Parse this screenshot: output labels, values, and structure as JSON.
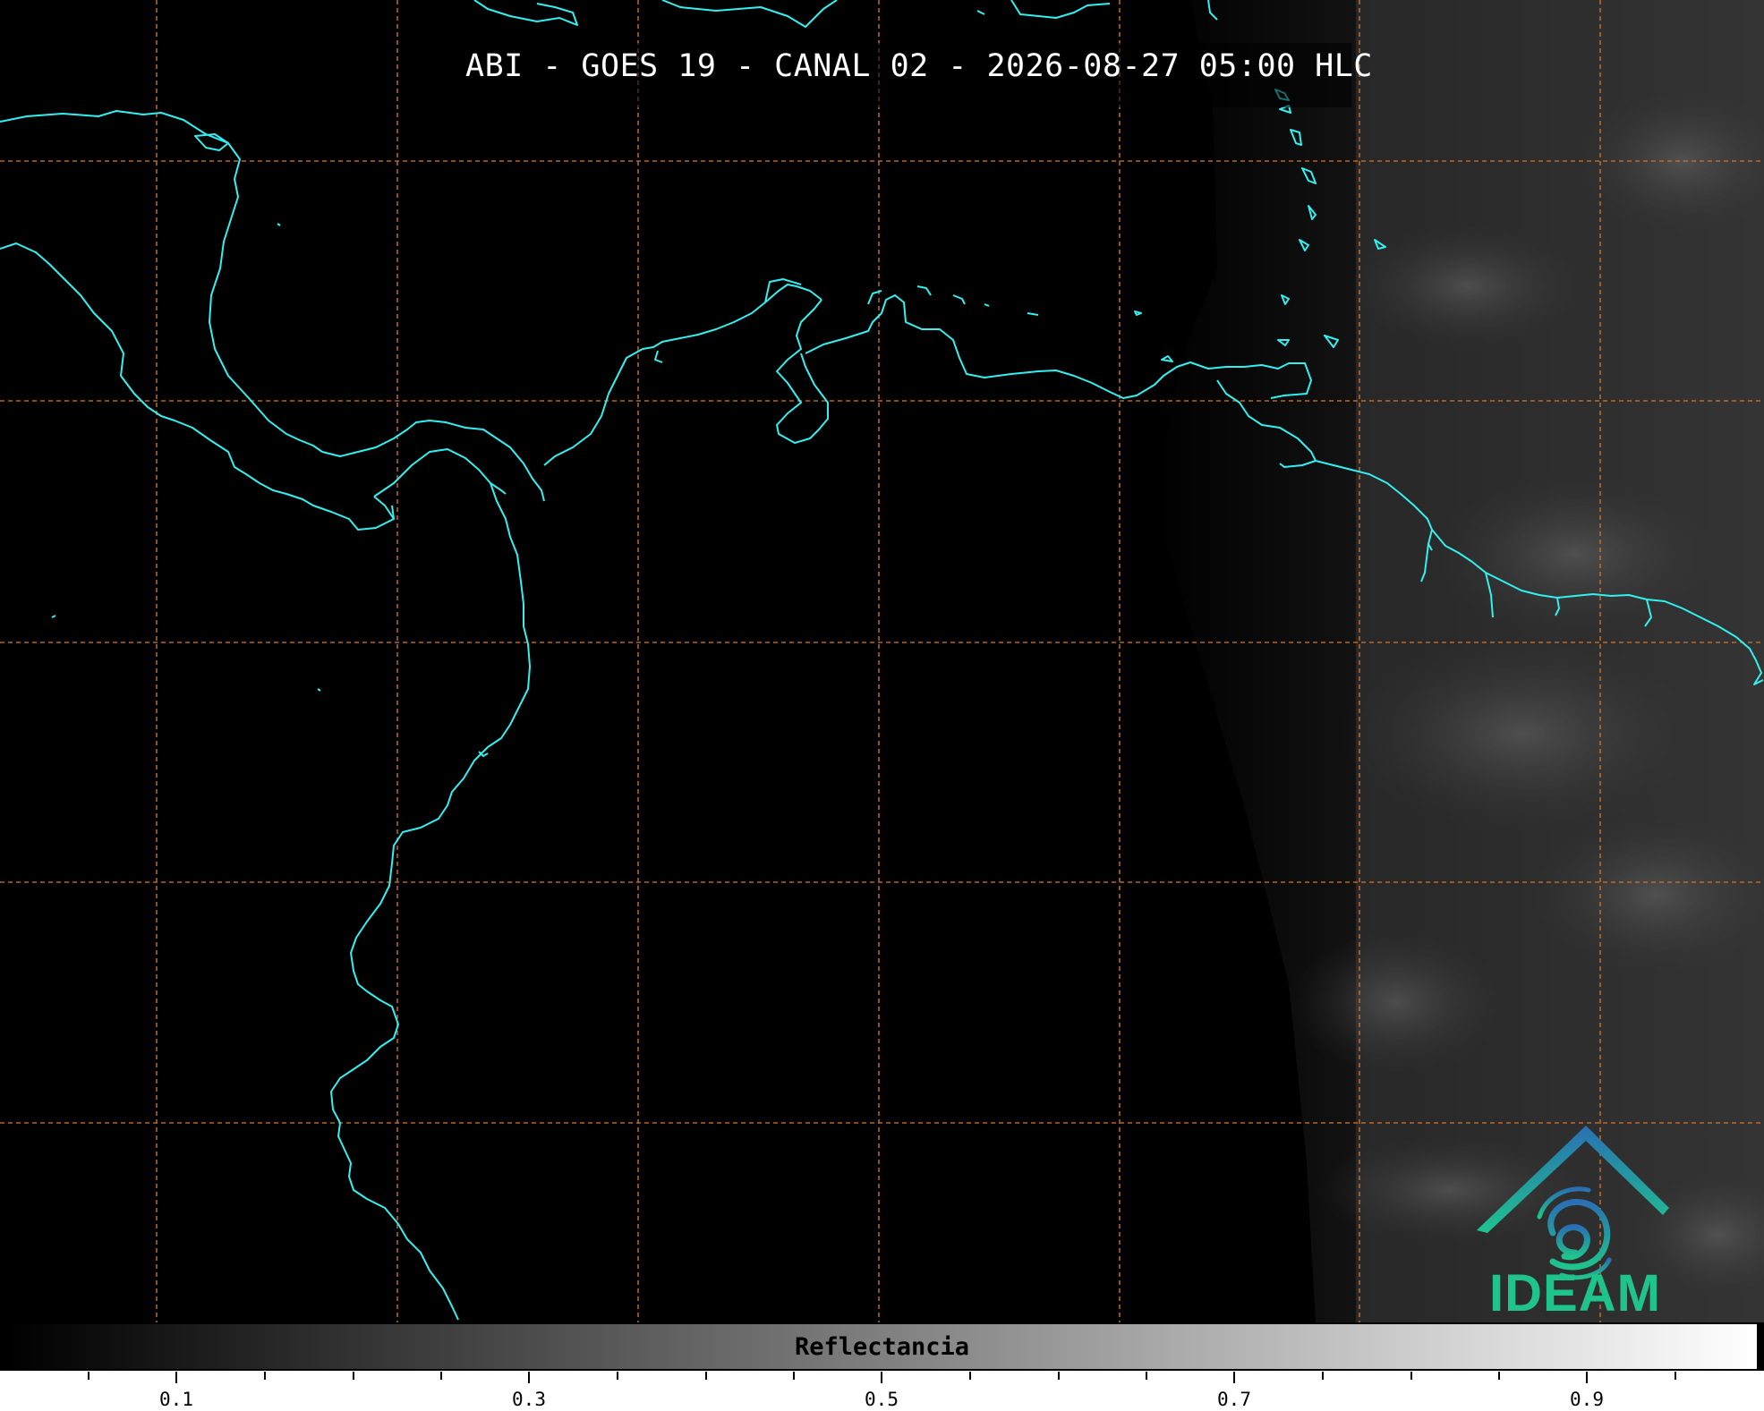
{
  "map": {
    "title": "ABI - GOES 19 - CANAL 02 - 2026-08-27 05:00 HLC",
    "background_color": "#000000",
    "coastline_color": "#33f0f0",
    "graticule_color": "#c8702a",
    "graticule_style": "dashed"
  },
  "colorbar": {
    "label": "Reflectancia",
    "gradient": [
      "#000000",
      "#ffffff"
    ],
    "ticks": [
      "0.1",
      "0.3",
      "0.5",
      "0.7",
      "0.9"
    ]
  },
  "logo": {
    "name": "ideam-logo",
    "text": "IDEAM",
    "colors": [
      "#2a6fb3",
      "#1fc48d"
    ]
  }
}
